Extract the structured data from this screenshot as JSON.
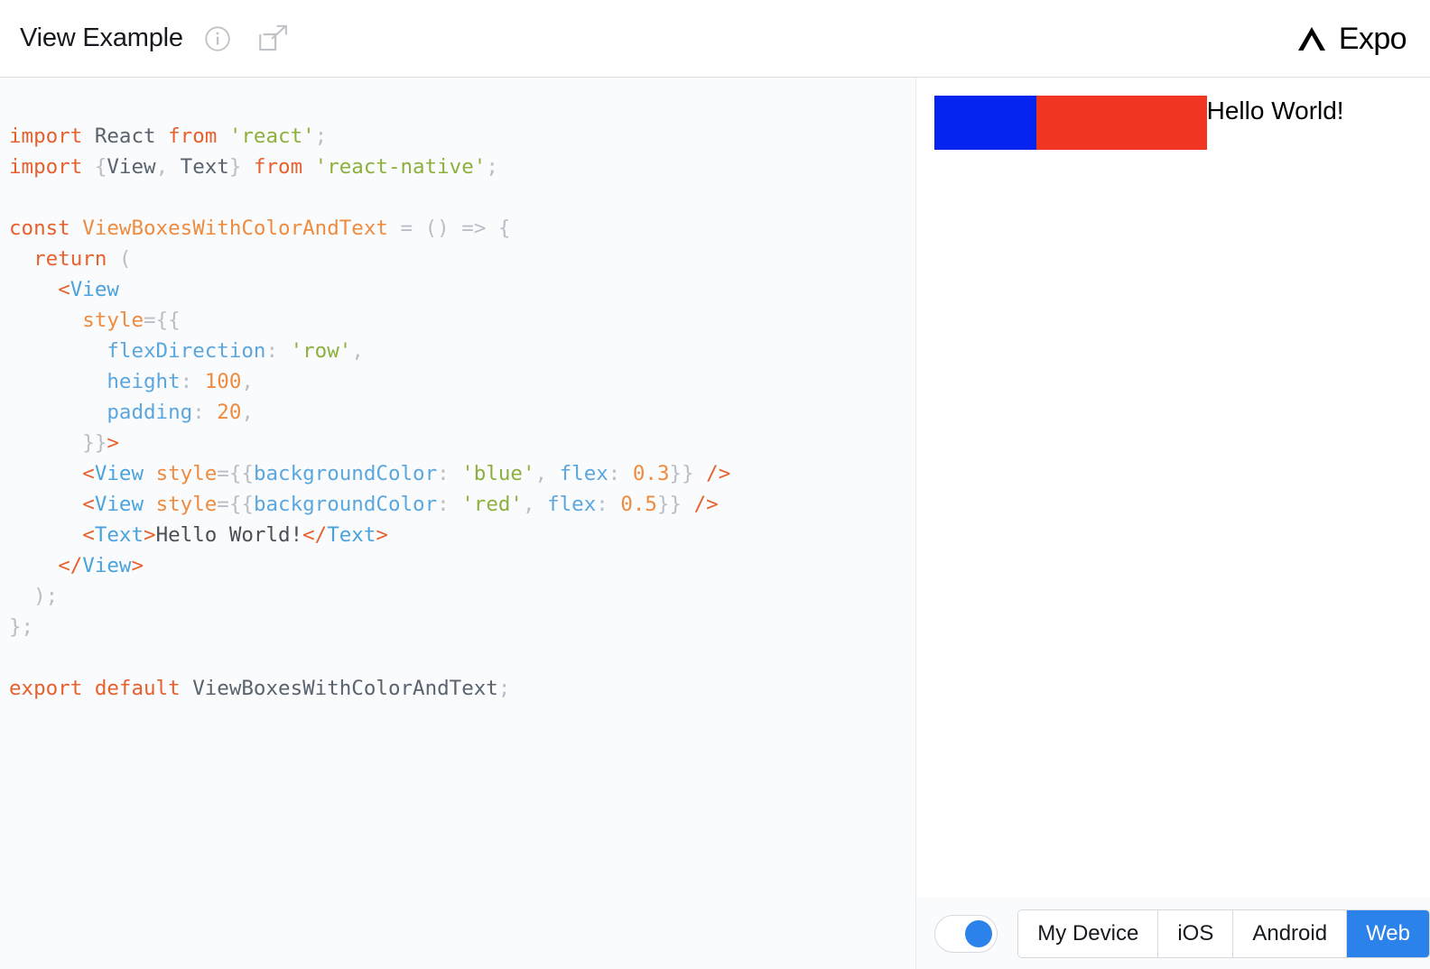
{
  "header": {
    "title": "View Example",
    "info_icon": "info-circle-icon",
    "share_icon": "external-link-icon",
    "brand": "Expo",
    "brand_mark": "expo-chevron-logo"
  },
  "editor": {
    "language": "jsx",
    "lines": [
      "import React from 'react';",
      "import {View, Text} from 'react-native';",
      "",
      "const ViewBoxesWithColorAndText = () => {",
      "  return (",
      "    <View",
      "      style={{",
      "        flexDirection: 'row',",
      "        height: 100,",
      "        padding: 20,",
      "      }}>",
      "      <View style={{backgroundColor: 'blue', flex: 0.3}} />",
      "      <View style={{backgroundColor: 'red', flex: 0.5}} />",
      "      <Text>Hello World!</Text>",
      "    </View>",
      "  );",
      "};",
      "",
      "export default ViewBoxesWithColorAndText;"
    ]
  },
  "preview": {
    "text": "Hello World!",
    "blue_box_color": "#0524f0",
    "red_box_color": "#f03523",
    "blue_box_flex": "0.3",
    "red_box_flex": "0.5",
    "container_height": "100",
    "container_padding": "20",
    "flex_direction": "row"
  },
  "toolbar": {
    "toggle_state": "on",
    "toggle_accent": "#2b82eb",
    "targets": [
      {
        "label": "My Device",
        "active": false
      },
      {
        "label": "iOS",
        "active": false
      },
      {
        "label": "Android",
        "active": false
      },
      {
        "label": "Web",
        "active": true
      }
    ]
  },
  "theme": {
    "accent": "#2b82eb",
    "editor_bg": "#f9fbfd",
    "keyword": "#e8602c",
    "string": "#8db03c",
    "property": "#5ba7dd",
    "tag": "#4ba3de",
    "number": "#ef8b3f",
    "punctuation": "#b8bec6",
    "identifier": "#5a636d"
  }
}
